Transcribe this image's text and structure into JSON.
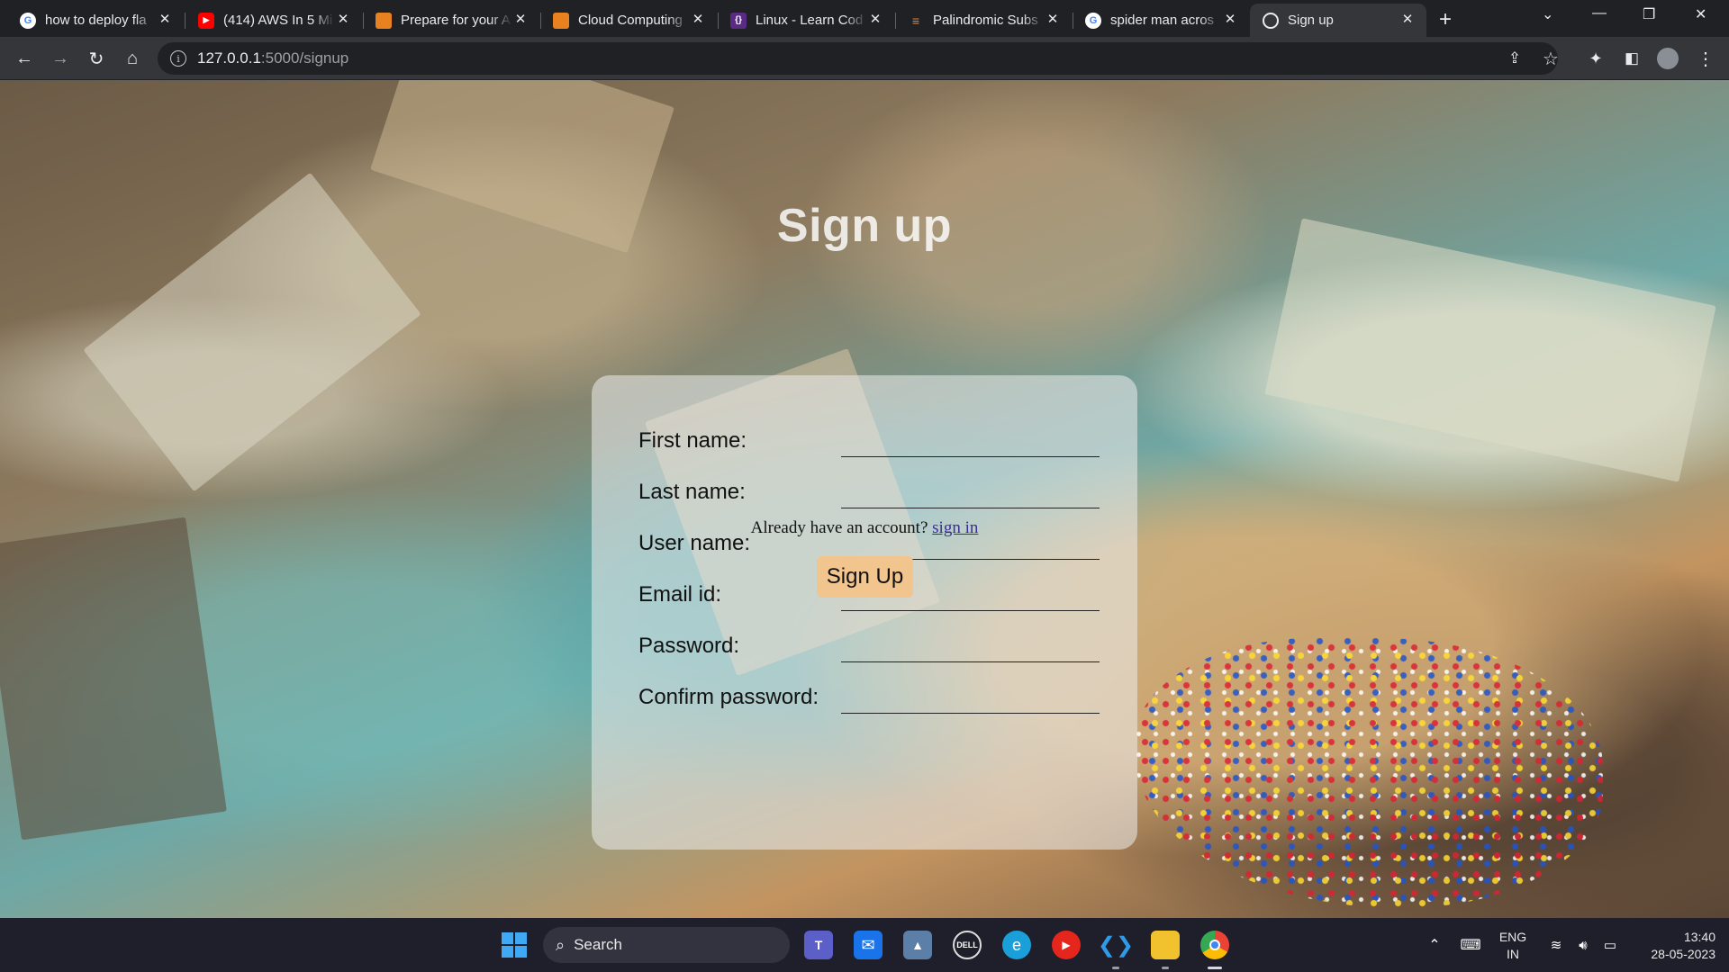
{
  "browser": {
    "tabs": [
      {
        "label": "how to deploy fla",
        "favicon": "google-icon",
        "active": false
      },
      {
        "label": "(414) AWS In 5 Mi",
        "favicon": "youtube-icon",
        "active": false
      },
      {
        "label": "Prepare for your A",
        "favicon": "aws-hex-icon",
        "active": false
      },
      {
        "label": "Cloud Computing",
        "favicon": "aws-hex-icon",
        "active": false
      },
      {
        "label": "Linux - Learn Cod",
        "favicon": "curly-brace-icon",
        "active": false
      },
      {
        "label": "Palindromic Subs",
        "favicon": "stack-icon",
        "active": false
      },
      {
        "label": "spider man acros",
        "favicon": "google-icon",
        "active": false
      },
      {
        "label": "Sign up",
        "favicon": "globe-icon",
        "active": true
      }
    ],
    "new_tab_symbol": "+",
    "url_host": "127.0.0.1",
    "url_path": ":5000/signup"
  },
  "page": {
    "title": "Sign up",
    "fields": [
      {
        "label": "First name:",
        "value": ""
      },
      {
        "label": "Last name:",
        "value": ""
      },
      {
        "label": "User name:",
        "value": ""
      },
      {
        "label": "Email id:",
        "value": ""
      },
      {
        "label": "Password:",
        "value": ""
      },
      {
        "label": "Confirm password:",
        "value": ""
      }
    ],
    "signin_prompt": "Already have an account?",
    "signin_link": "sign in",
    "submit_label": "Sign Up"
  },
  "taskbar": {
    "search_label": "Search",
    "language_line1": "ENG",
    "language_line2": "IN",
    "time": "13:40",
    "date": "28-05-2023"
  },
  "colors": {
    "tab_bar": "#202124",
    "toolbar": "#35363a",
    "card": "rgba(236,236,236,0.56)",
    "submit_button": "#f2c48e",
    "link": "#3a2d9a",
    "taskbar": "#1f1f2b"
  }
}
